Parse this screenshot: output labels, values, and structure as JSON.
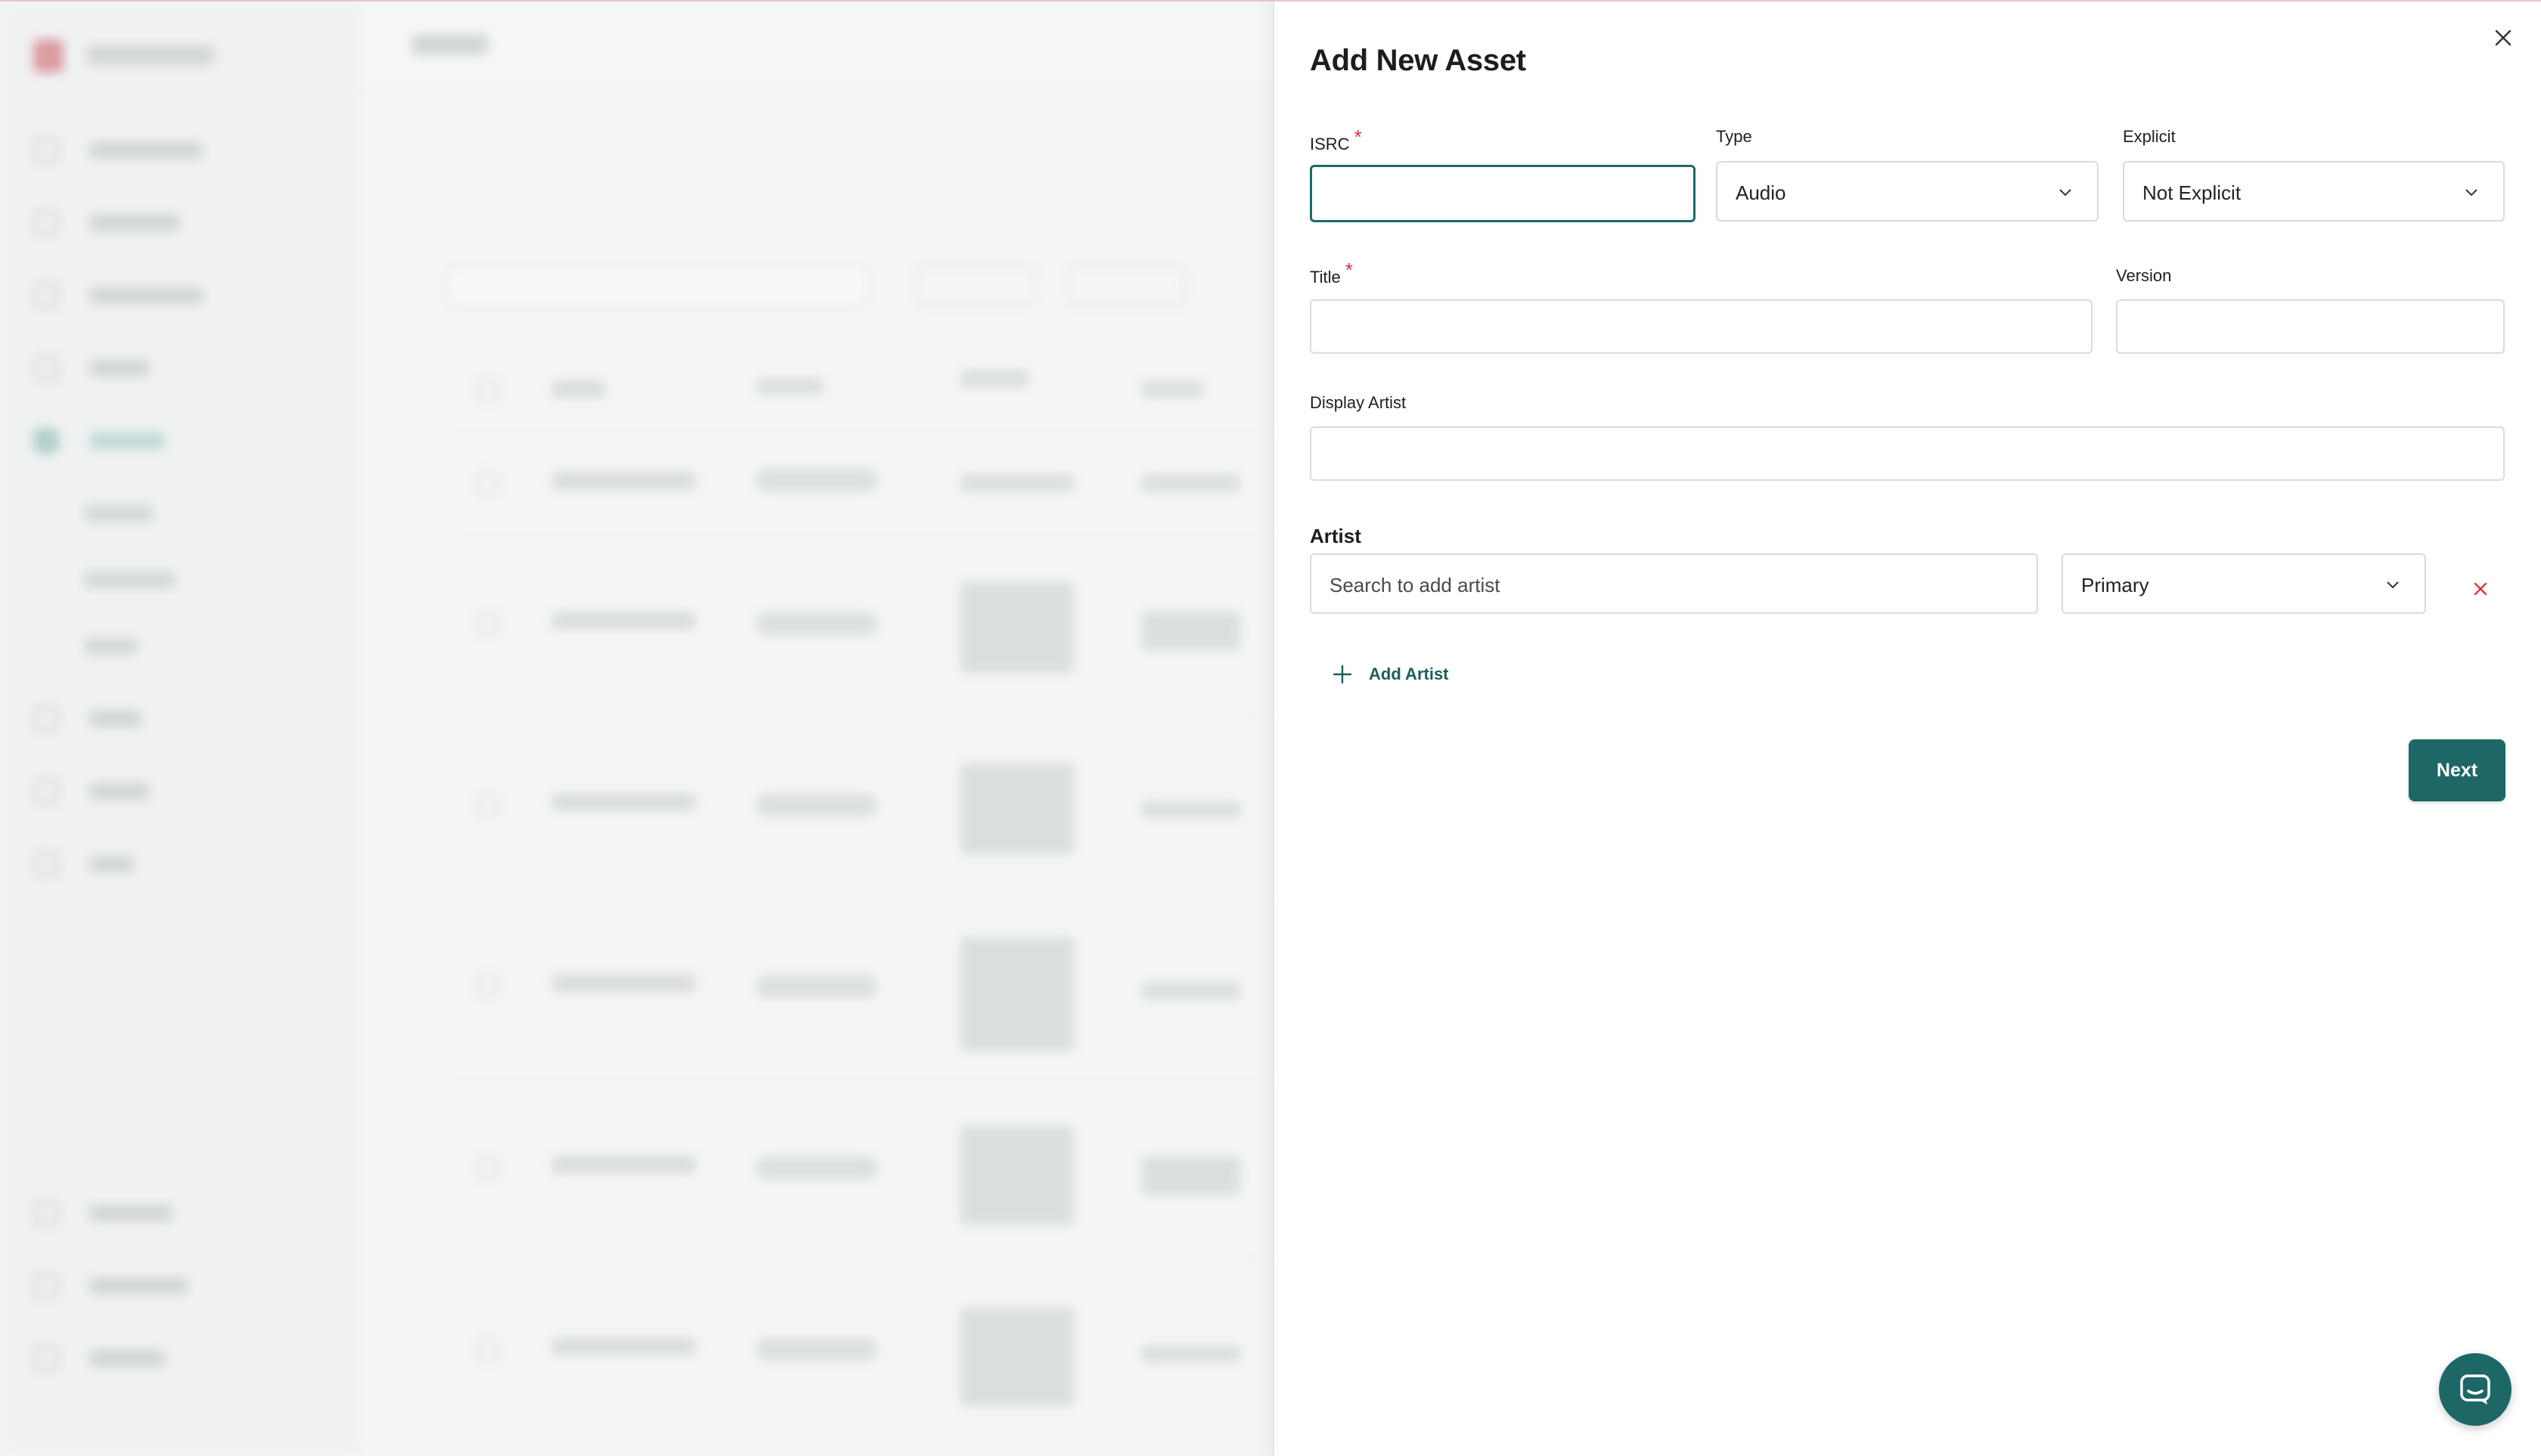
{
  "drawer": {
    "title": "Add New Asset",
    "close_icon": "close-icon"
  },
  "form": {
    "isrc": {
      "label": "ISRC",
      "required_mark": "*",
      "value": ""
    },
    "type": {
      "label": "Type",
      "value": "Audio"
    },
    "explicit": {
      "label": "Explicit",
      "value": "Not Explicit"
    },
    "title": {
      "label": "Title",
      "required_mark": "*",
      "value": ""
    },
    "version": {
      "label": "Version",
      "value": ""
    },
    "display_artist": {
      "label": "Display Artist",
      "value": ""
    }
  },
  "artist_section": {
    "heading": "Artist",
    "search_placeholder": "Search to add artist",
    "role_value": "Primary",
    "add_artist_label": "Add Artist"
  },
  "actions": {
    "next_label": "Next"
  },
  "colors": {
    "accent": "#1d6767",
    "required": "#d6343f",
    "remove": "#e0343f"
  },
  "icons": {
    "close": "close-icon",
    "chevron": "chevron-down-icon",
    "remove": "remove-artist-icon",
    "add": "plus-icon",
    "chat": "chat-icon"
  }
}
